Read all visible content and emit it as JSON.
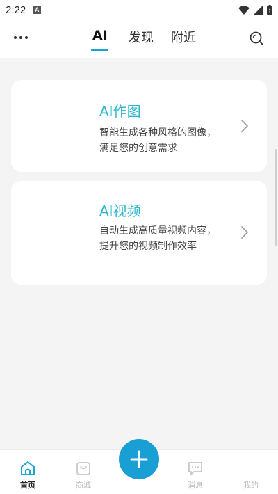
{
  "status_bar": {
    "time": "2:22",
    "notification_badge": "A",
    "icons": [
      "wifi-icon",
      "signal-icon",
      "battery-icon"
    ]
  },
  "top_nav": {
    "menu_icon": "more-dots-icon",
    "tabs": [
      {
        "label": "AI",
        "active": true
      },
      {
        "label": "发现",
        "active": false
      },
      {
        "label": "附近",
        "active": false
      }
    ],
    "search_icon": "search-icon",
    "accent_color": "#1aa3d4"
  },
  "cards": [
    {
      "title": "AI作图",
      "description": "智能生成各种风格的图像，满足您的创意需求"
    },
    {
      "title": "AI视频",
      "description": "自动生成高质量视频内容，提升您的视频制作效率"
    }
  ],
  "colors": {
    "card_title": "#2cb7cc",
    "fab": "#1a9fd4",
    "background": "#f4f4f4"
  },
  "bottom_nav": {
    "items": [
      {
        "label": "首页",
        "icon": "home-icon",
        "active": true
      },
      {
        "label": "商城",
        "icon": "shopping-bag-icon",
        "active": false
      },
      {
        "label": "消息",
        "icon": "message-icon",
        "active": false
      },
      {
        "label": "我的",
        "icon": "profile-icon",
        "active": false
      }
    ],
    "fab_icon": "plus-icon"
  }
}
